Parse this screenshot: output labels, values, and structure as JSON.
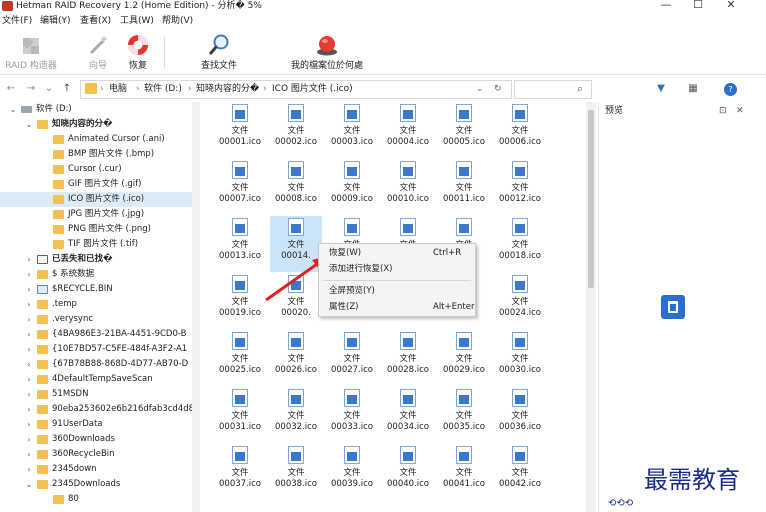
{
  "window": {
    "title": "Hetman RAID Recovery 1.2 (Home Edition) - 分析� 5%",
    "minimize_icon": "—",
    "maximize_icon": "☐",
    "close_icon": "✕"
  },
  "menu": [
    "文件(F)",
    "编辑(Y)",
    "查看(X)",
    "工具(W)",
    "帮助(V)"
  ],
  "toolbar": [
    {
      "label": "RAID 构造器",
      "enabled": false,
      "icon": "puzzle-icon"
    },
    {
      "label": "向导",
      "enabled": false,
      "icon": "magic-wand-icon"
    },
    {
      "label": "恢复",
      "enabled": true,
      "icon": "lifebuoy-icon"
    },
    {
      "label": "查找文件",
      "enabled": true,
      "icon": "magnifier-icon"
    },
    {
      "label": "我的檔案位於何處",
      "enabled": true,
      "icon": "red-button-icon"
    }
  ],
  "address": {
    "back": "←",
    "forward": "→",
    "dropdown": "⌄",
    "up": "↑",
    "crumbs": [
      "电脑",
      "软件 (D:)",
      "知晓内容的分�",
      "ICO 图片文件 (.ico)"
    ],
    "refresh": "↻",
    "search_icon": "⌕",
    "filter_icon": "▼",
    "view_icon": "▦",
    "help_icon": "?"
  },
  "tree": [
    {
      "label": "软件 (D:)",
      "level": 0,
      "expander": "⌄",
      "type": "drive"
    },
    {
      "label": "知晓内容的分�",
      "level": 1,
      "expander": "⌄",
      "type": "folder",
      "bold": true
    },
    {
      "label": "Animated Cursor (.ani)",
      "level": 2,
      "expander": "",
      "type": "folder"
    },
    {
      "label": "BMP 图片文件 (.bmp)",
      "level": 2,
      "expander": "",
      "type": "folder"
    },
    {
      "label": "Cursor (.cur)",
      "level": 2,
      "expander": "",
      "type": "folder"
    },
    {
      "label": "GIF 图片文件 (.gif)",
      "level": 2,
      "expander": "",
      "type": "folder"
    },
    {
      "label": "ICO 图片文件 (.ico)",
      "level": 2,
      "expander": "",
      "type": "folder",
      "selected": true
    },
    {
      "label": "JPG 图片文件 (.jpg)",
      "level": 2,
      "expander": "",
      "type": "folder"
    },
    {
      "label": "PNG 图片文件 (.png)",
      "level": 2,
      "expander": "",
      "type": "folder"
    },
    {
      "label": "TIF 图片文件 (.tif)",
      "level": 2,
      "expander": "",
      "type": "folder"
    },
    {
      "label": "已丢失和已找�",
      "level": 1,
      "expander": "›",
      "type": "lost",
      "bold": true
    },
    {
      "label": "$ 系统数据",
      "level": 1,
      "expander": "›",
      "type": "folder"
    },
    {
      "label": "$RECYCLE.BIN",
      "level": 1,
      "expander": "›",
      "type": "recycle"
    },
    {
      "label": ".temp",
      "level": 1,
      "expander": "›",
      "type": "folder"
    },
    {
      "label": ".verysync",
      "level": 1,
      "expander": "›",
      "type": "folder"
    },
    {
      "label": "{4BA986E3-21BA-4451-9CD0-B",
      "level": 1,
      "expander": "›",
      "type": "folder"
    },
    {
      "label": "{10E7BD57-C5FE-484f-A3F2-A1",
      "level": 1,
      "expander": "›",
      "type": "folder"
    },
    {
      "label": "{67B78B88-868D-4D77-AB70-D",
      "level": 1,
      "expander": "›",
      "type": "folder"
    },
    {
      "label": "4DefaultTempSaveScan",
      "level": 1,
      "expander": "›",
      "type": "folder"
    },
    {
      "label": "51MSDN",
      "level": 1,
      "expander": "›",
      "type": "folder"
    },
    {
      "label": "90eba253602e6b216dfab3cd4d8",
      "level": 1,
      "expander": "›",
      "type": "folder"
    },
    {
      "label": "91UserData",
      "level": 1,
      "expander": "›",
      "type": "folder"
    },
    {
      "label": "360Downloads",
      "level": 1,
      "expander": "›",
      "type": "folder"
    },
    {
      "label": "360RecycleBin",
      "level": 1,
      "expander": "›",
      "type": "folder"
    },
    {
      "label": "2345down",
      "level": 1,
      "expander": "›",
      "type": "folder"
    },
    {
      "label": "2345Downloads",
      "level": 1,
      "expander": "⌄",
      "type": "folder"
    },
    {
      "label": "80",
      "level": 2,
      "expander": "",
      "type": "folder"
    }
  ],
  "files": {
    "type_label": "文件",
    "names": [
      "00001.ico",
      "00002.ico",
      "00003.ico",
      "00004.ico",
      "00005.ico",
      "00006.ico",
      "00007.ico",
      "00008.ico",
      "00009.ico",
      "00010.ico",
      "00011.ico",
      "00012.ico",
      "00013.ico",
      "00014.",
      "",
      "",
      "",
      "00018.ico",
      "00019.ico",
      "00020.",
      "",
      "",
      "",
      "00024.ico",
      "00025.ico",
      "00026.ico",
      "00027.ico",
      "00028.ico",
      "00029.ico",
      "00030.ico",
      "00031.ico",
      "00032.ico",
      "00033.ico",
      "00034.ico",
      "00035.ico",
      "00036.ico",
      "00037.ico",
      "00038.ico",
      "00039.ico",
      "00040.ico",
      "00041.ico",
      "00042.ico"
    ],
    "selected_index": 13
  },
  "context_menu": [
    {
      "label": "恢复(W)",
      "shortcut": "Ctrl+R"
    },
    {
      "label": "添加进行恢复(X)",
      "shortcut": ""
    },
    {
      "label": "全屏预览(Y)",
      "shortcut": ""
    },
    {
      "label": "属性(Z)",
      "shortcut": "Alt+Enter"
    }
  ],
  "preview": {
    "title": "预览",
    "pin_icon": "⊡",
    "close_icon": "✕"
  },
  "watermark": {
    "text": "最需教育",
    "sub": "⟲⟲⟲"
  }
}
